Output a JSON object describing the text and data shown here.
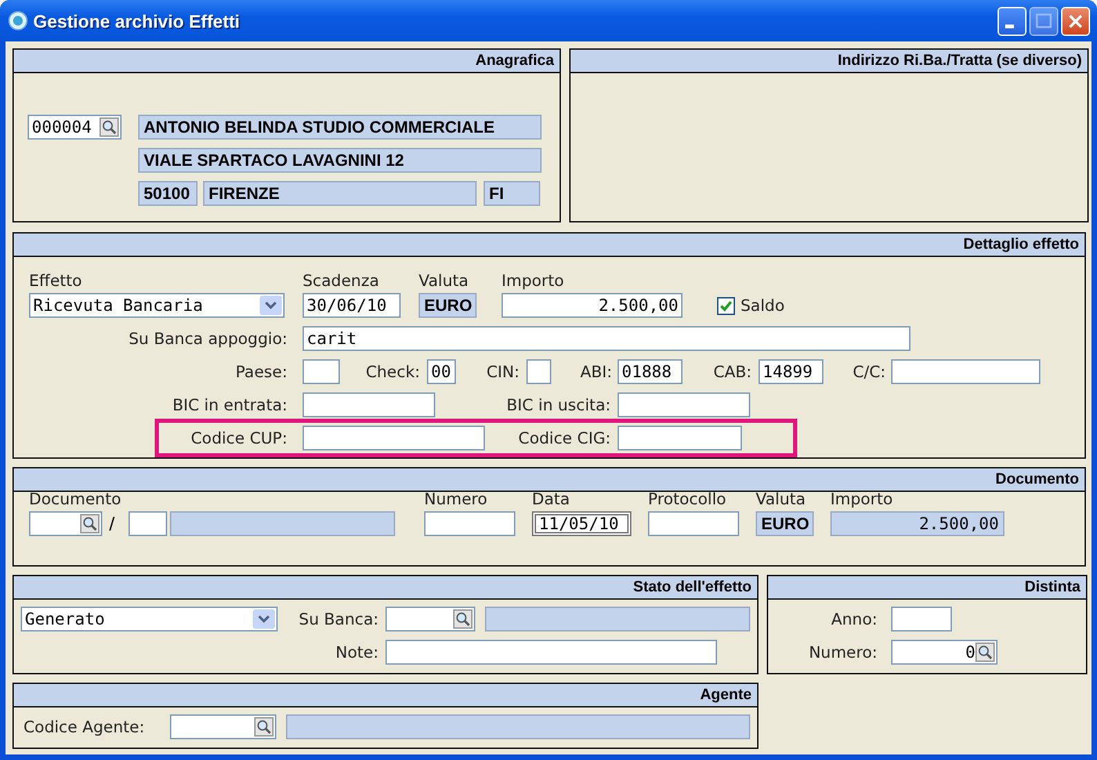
{
  "window": {
    "title": "Gestione archivio Effetti"
  },
  "anagrafica": {
    "title": "Anagrafica",
    "code": "000004",
    "name": "ANTONIO BELINDA STUDIO COMMERCIALE",
    "address": "VIALE SPARTACO LAVAGNINI 12",
    "cap": "50100",
    "city": "FIRENZE",
    "province": "FI"
  },
  "indirizzo": {
    "title": "Indirizzo Ri.Ba./Tratta (se diverso)"
  },
  "dettaglio": {
    "title": "Dettaglio effetto",
    "effetto": {
      "label": "Effetto",
      "value": "Ricevuta Bancaria"
    },
    "scadenza": {
      "label": "Scadenza",
      "value": "30/06/10"
    },
    "valuta": {
      "label": "Valuta",
      "value": "EURO"
    },
    "importo": {
      "label": "Importo",
      "value": "2.500,00"
    },
    "saldo": {
      "label": "Saldo",
      "checked": true
    },
    "banca_appoggio": {
      "label": "Su Banca appoggio:",
      "value": "carit"
    },
    "paese": {
      "label": "Paese:"
    },
    "check": {
      "label": "Check:",
      "value": "00"
    },
    "cin": {
      "label": "CIN:"
    },
    "abi": {
      "label": "ABI:",
      "value": "01888"
    },
    "cab": {
      "label": "CAB:",
      "value": "14899"
    },
    "cc": {
      "label": "C/C:"
    },
    "bic_entrata": {
      "label": "BIC in entrata:"
    },
    "bic_uscita": {
      "label": "BIC in uscita:"
    },
    "codici": {
      "highlighted": true,
      "cup": {
        "label": "Codice CUP:"
      },
      "cig": {
        "label": "Codice CIG:"
      }
    }
  },
  "documento": {
    "title": "Documento",
    "documento": {
      "label": "Documento"
    },
    "numero": {
      "label": "Numero"
    },
    "data": {
      "label": "Data",
      "value": "11/05/10",
      "focused": true
    },
    "protocollo": {
      "label": "Protocollo"
    },
    "valuta": {
      "label": "Valuta",
      "value": "EURO"
    },
    "importo": {
      "label": "Importo",
      "value": "2.500,00"
    }
  },
  "stato": {
    "title": "Stato dell'effetto",
    "stato": {
      "value": "Generato"
    },
    "su_banca": {
      "label": "Su Banca:"
    },
    "note": {
      "label": "Note:"
    }
  },
  "distinta": {
    "title": "Distinta",
    "anno": {
      "label": "Anno:"
    },
    "numero": {
      "label": "Numero:",
      "value": "0"
    }
  },
  "agente": {
    "title": "Agente",
    "codice": {
      "label": "Codice Agente:"
    }
  }
}
